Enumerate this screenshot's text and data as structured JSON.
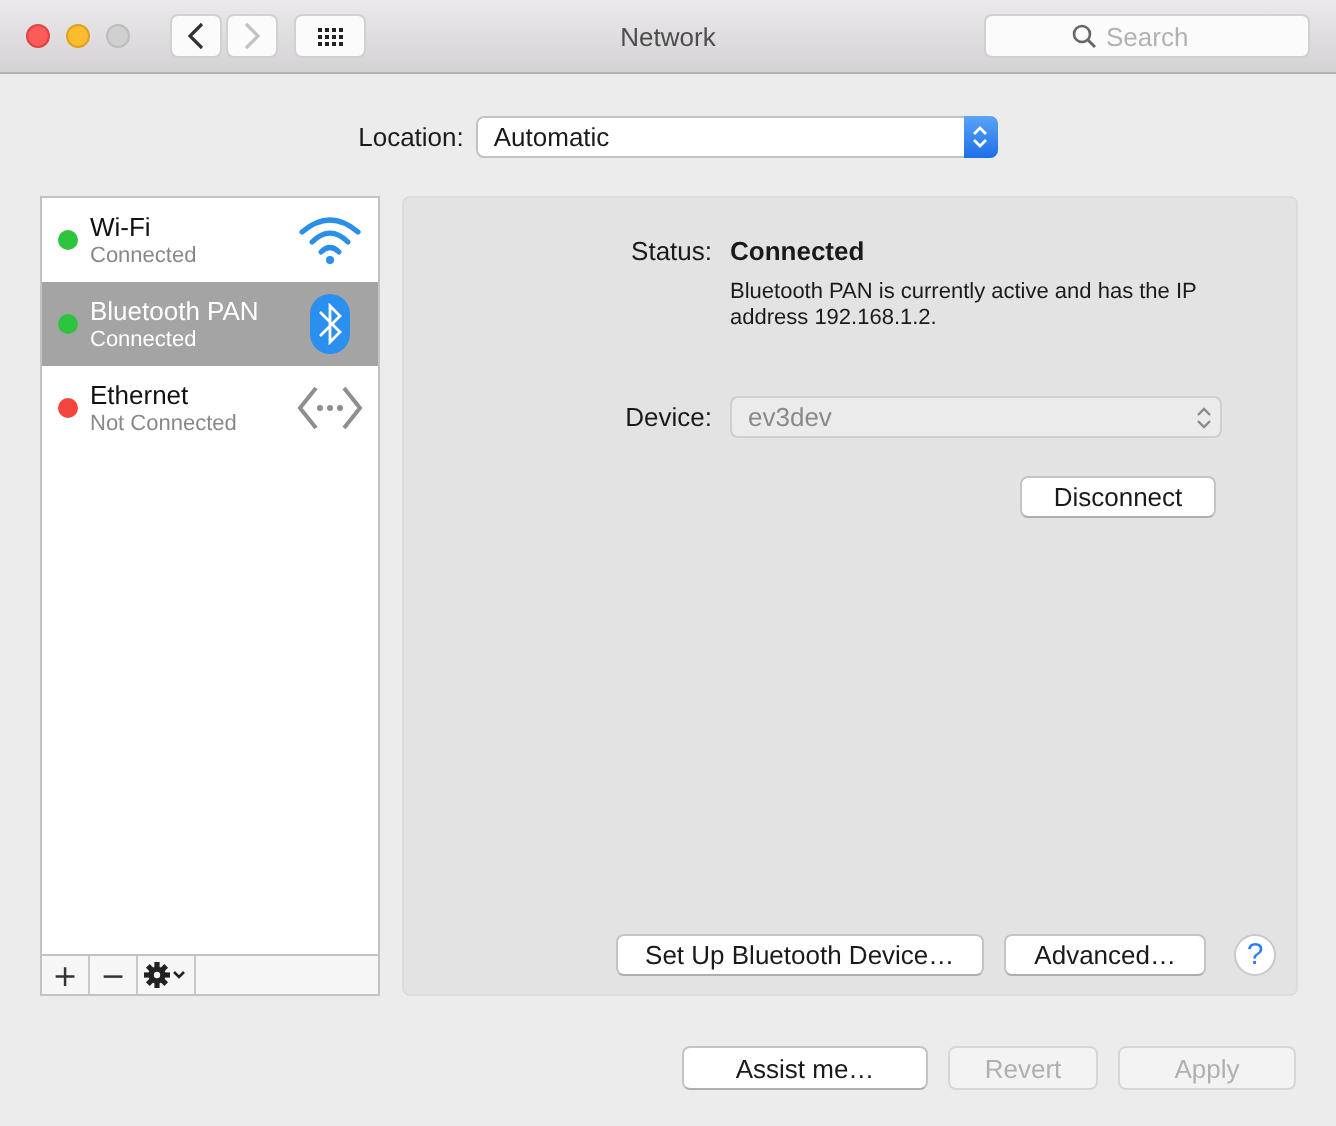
{
  "window": {
    "title": "Network"
  },
  "search": {
    "placeholder": "Search"
  },
  "location": {
    "label": "Location:",
    "value": "Automatic"
  },
  "services": [
    {
      "kind": "wifi",
      "name": "Wi-Fi",
      "status": "Connected",
      "color": "#2ec33d",
      "selected": false
    },
    {
      "kind": "bluetooth",
      "name": "Bluetooth PAN",
      "status": "Connected",
      "color": "#2ec33d",
      "selected": true
    },
    {
      "kind": "ethernet",
      "name": "Ethernet",
      "status": "Not Connected",
      "color": "#f2453d",
      "selected": false
    }
  ],
  "list_buttons": [
    "+",
    "−"
  ],
  "detail": {
    "status_label": "Status:",
    "status_value": "Connected",
    "description": "Bluetooth PAN is currently active and has the IP address 192.168.1.2.",
    "device_label": "Device:",
    "device_value": "ev3dev",
    "device_disabled": true,
    "disconnect": {
      "label": "Disconnect",
      "disabled": false
    },
    "buttons": [
      {
        "label": "Set Up Bluetooth Device…",
        "disabled": false
      },
      {
        "label": "Advanced…",
        "disabled": false
      }
    ],
    "help": "?"
  },
  "footer_buttons": [
    {
      "label": "Assist me…",
      "disabled": false
    },
    {
      "label": "Revert",
      "disabled": true
    },
    {
      "label": "Apply",
      "disabled": true
    }
  ]
}
